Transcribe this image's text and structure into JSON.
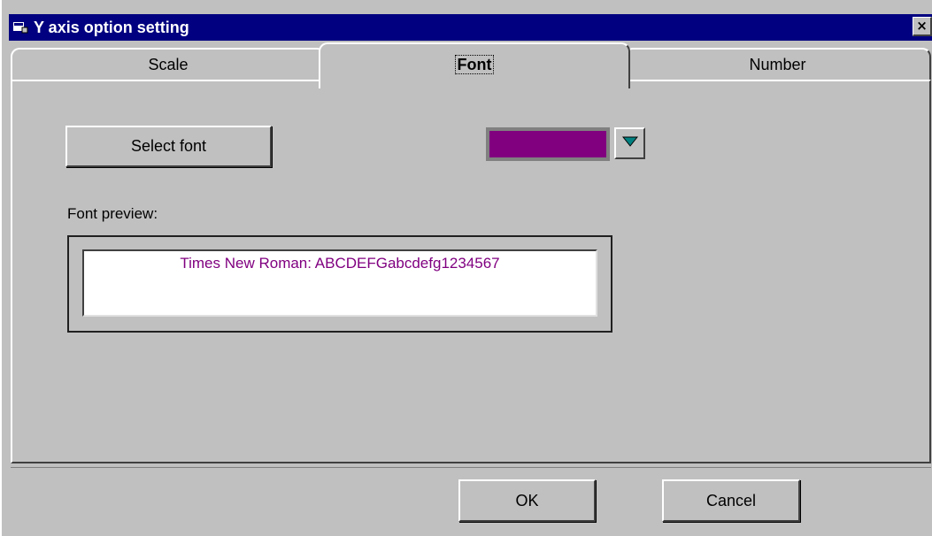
{
  "window": {
    "title": "Y axis option setting",
    "close_label": "×"
  },
  "tabs": [
    {
      "label": "Scale"
    },
    {
      "label": "Font"
    },
    {
      "label": "Number"
    }
  ],
  "font_page": {
    "select_font_label": "Select font",
    "color_value": "#800080",
    "preview_label": "Font preview:",
    "preview_text": "Times New Roman: ABCDEFGabcdefg1234567"
  },
  "buttons": {
    "ok_label": "OK",
    "cancel_label": "Cancel"
  },
  "icons": {
    "window_icon": "app-window-icon",
    "dropdown_icon": "triangle-down-icon"
  },
  "colors": {
    "title_bar": "#000080",
    "face": "#c0c0c0",
    "preview_text": "#800080",
    "dropdown_arrow": "#008080"
  }
}
